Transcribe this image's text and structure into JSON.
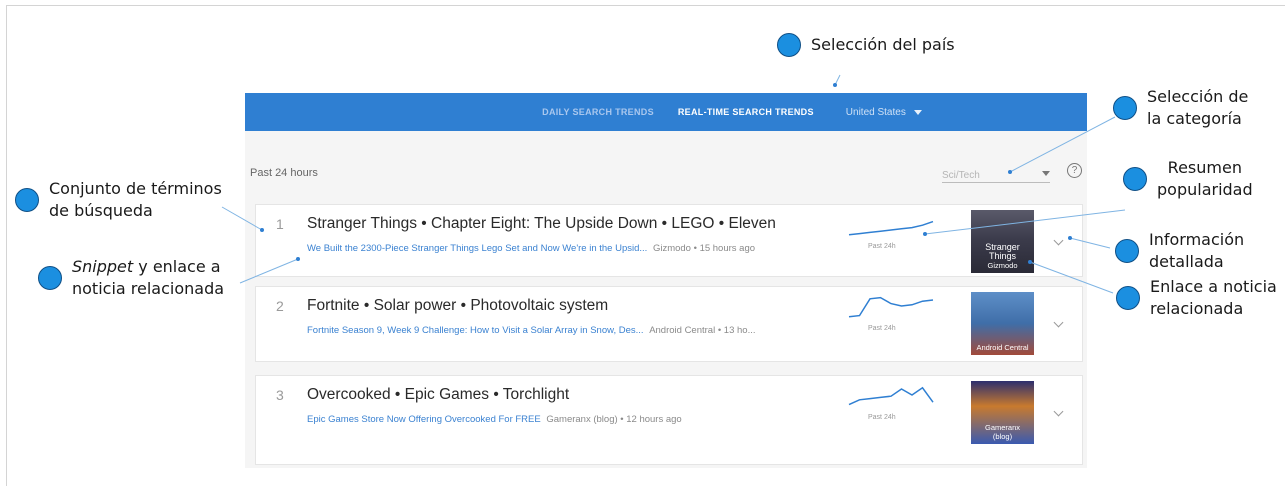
{
  "annotations": {
    "country": "Selección del país",
    "category_line1": "Selección de",
    "category_line2": "la categoría",
    "popularity_line1": "Resumen",
    "popularity_line2": "popularidad",
    "terms_line1": "Conjunto de términos",
    "terms_line2": "de búsqueda",
    "snippet_italic": "Snippet",
    "snippet_line1_rest": " y enlace a",
    "snippet_line2": "noticia relacionada",
    "details_line1": "Información",
    "details_line2": "detallada",
    "news_link_line1": "Enlace a noticia",
    "news_link_line2": "relacionada"
  },
  "header": {
    "tab_daily": "DAILY SEARCH TRENDS",
    "tab_realtime": "REAL-TIME SEARCH TRENDS",
    "country": "United States"
  },
  "filters": {
    "period": "Past 24 hours",
    "category": "Sci/Tech",
    "help": "?"
  },
  "trends": [
    {
      "rank": "1",
      "terms": "Stranger Things • Chapter Eight: The Upside Down • LEGO • Eleven",
      "snippet": "We Built the 2300-Piece Stranger Things Lego Set and Now We're in the Upsid...",
      "source": "Gizmodo • 15 hours ago",
      "period": "Past 24h",
      "thumb_caption_1": "Stranger Things",
      "thumb_caption_2": "Gizmodo",
      "spark": [
        0.05,
        0.1,
        0.15,
        0.2,
        0.25,
        0.3,
        0.35,
        0.45,
        0.6
      ]
    },
    {
      "rank": "2",
      "terms": "Fortnite • Solar power • Photovoltaic system",
      "snippet": "Fortnite Season 9, Week 9 Challenge: How to Visit a Solar Array in Snow, Des...",
      "source": "Android Central • 13 ho...",
      "period": "Past 24h",
      "thumb_caption_1": "Android Central",
      "thumb_caption_2": "",
      "spark": [
        0.05,
        0.1,
        0.8,
        0.85,
        0.6,
        0.5,
        0.55,
        0.7,
        0.75
      ]
    },
    {
      "rank": "3",
      "terms": "Overcooked • Epic Games • Torchlight",
      "snippet": "Epic Games Store Now Offering Overcooked For FREE",
      "source": "Gameranx (blog) • 12 hours ago",
      "period": "Past 24h",
      "thumb_caption_1": "Gameranx",
      "thumb_caption_2": "(blog)",
      "spark": [
        0.1,
        0.3,
        0.35,
        0.4,
        0.45,
        0.75,
        0.5,
        0.8,
        0.2
      ]
    }
  ],
  "colors": {
    "accent": "#2f7fd2",
    "callout_dot": "#1b8fe0",
    "link": "#3b82d1"
  }
}
